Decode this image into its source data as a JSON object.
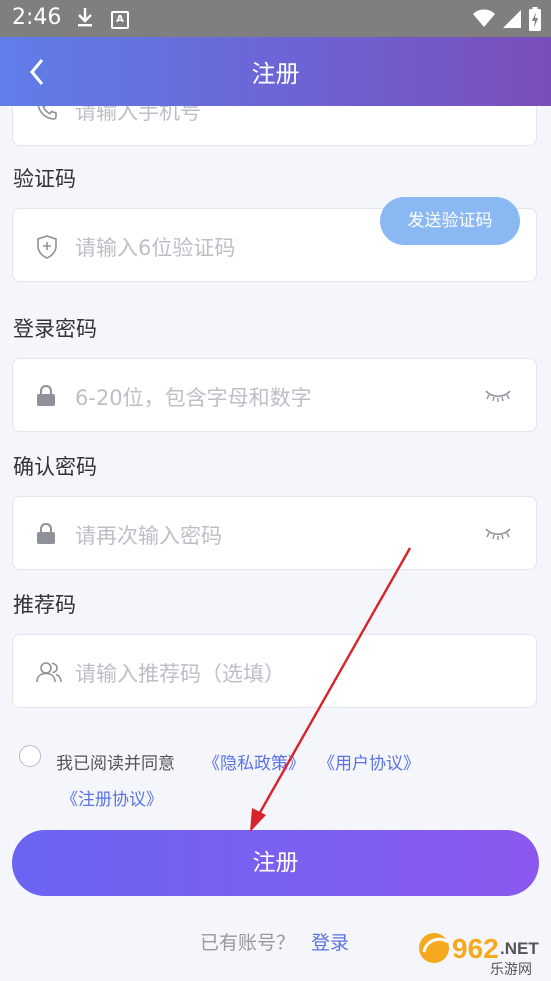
{
  "status_bar": {
    "time": "2:46",
    "badge": "A"
  },
  "header": {
    "title": "注册"
  },
  "phone": {
    "placeholder": "请输入手机号"
  },
  "code": {
    "label": "验证码",
    "placeholder": "请输入6位验证码",
    "send_button": "发送验证码"
  },
  "password": {
    "label": "登录密码",
    "placeholder": "6-20位，包含字母和数字"
  },
  "confirm": {
    "label": "确认密码",
    "placeholder": "请再次输入密码"
  },
  "referral": {
    "label": "推荐码",
    "placeholder": "请输入推荐码（选填）"
  },
  "agreement": {
    "prefix": "我已阅读并同意",
    "privacy": "《隐私政策》",
    "user": "《用户协议》",
    "register": "《注册协议》"
  },
  "submit_label": "注册",
  "login": {
    "hint": "已有账号？",
    "link": "登录"
  },
  "watermark": {
    "number": "962",
    "suffix": ".NET",
    "sub": "乐游网"
  },
  "colors": {
    "accent": "#5a72e6",
    "send_button": "#8ab8f2",
    "header_start": "#5f7ee9",
    "header_end": "#7a4eb8"
  }
}
